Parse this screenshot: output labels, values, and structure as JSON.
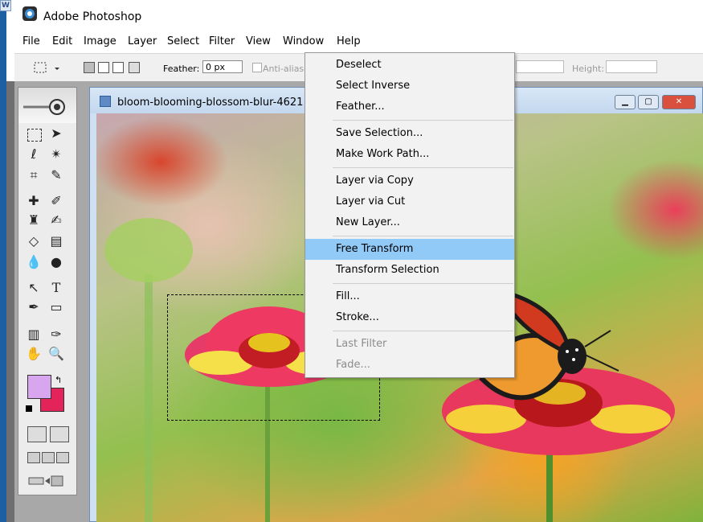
{
  "app": {
    "title": "Adobe Photoshop"
  },
  "menubar": [
    "File",
    "Edit",
    "Image",
    "Layer",
    "Select",
    "Filter",
    "View",
    "Window",
    "Help"
  ],
  "options": {
    "feather_label": "Feather:",
    "feather_value": "0 px",
    "antialias_label": "Anti-aliase",
    "height_label": "Height:"
  },
  "document": {
    "title": "bloom-blooming-blossom-blur-4621"
  },
  "select_menu": {
    "items": [
      {
        "label": "Deselect"
      },
      {
        "label": "Select Inverse"
      },
      {
        "label": "Feather..."
      },
      {
        "label": "Save Selection..."
      },
      {
        "label": "Make Work Path..."
      },
      {
        "label": "Layer via Copy"
      },
      {
        "label": "Layer via Cut"
      },
      {
        "label": "New Layer..."
      },
      {
        "label": "Free Transform",
        "highlighted": true
      },
      {
        "label": "Transform Selection"
      },
      {
        "label": "Fill..."
      },
      {
        "label": "Stroke..."
      },
      {
        "label": "Last Filter",
        "disabled": true
      },
      {
        "label": "Fade...",
        "disabled": true
      }
    ]
  },
  "colors": {
    "foreground": "#d7a6ef",
    "background": "#e2245a",
    "menu_highlight": "#91c9f7"
  }
}
